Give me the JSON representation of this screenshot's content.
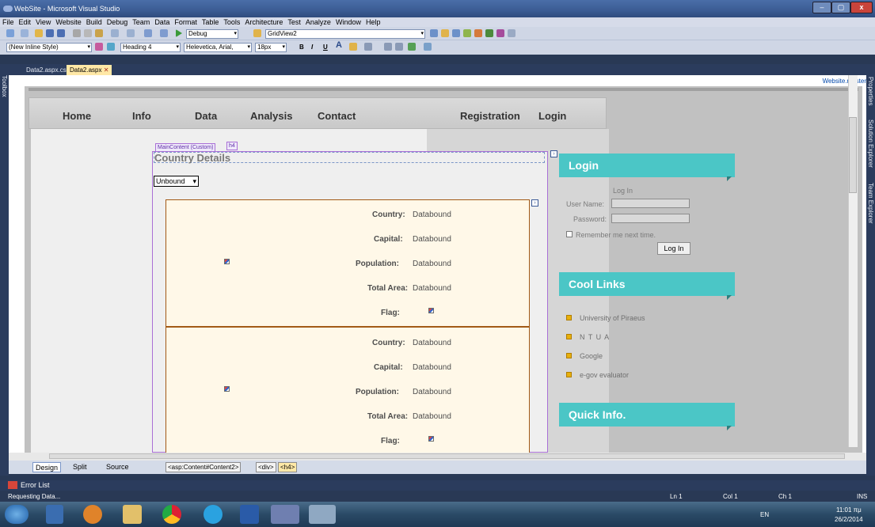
{
  "window": {
    "title": "WebSite - Microsoft Visual Studio",
    "min": "–",
    "max": "▢",
    "close": "x"
  },
  "menu": [
    "File",
    "Edit",
    "View",
    "Website",
    "Build",
    "Debug",
    "Team",
    "Data",
    "Format",
    "Table",
    "Tools",
    "Architecture",
    "Test",
    "Analyze",
    "Window",
    "Help"
  ],
  "toolbar1": {
    "config": "Debug",
    "target": "GridView2"
  },
  "toolbar2": {
    "style": "(New Inline Style)",
    "block": "Heading 4",
    "font": "Helevetica, Arial,",
    "size": "18px",
    "bold": "B",
    "italic": "I",
    "underline": "U",
    "fontcolor": "A"
  },
  "toolbox_label": "Toolbox",
  "tabs": [
    {
      "label": "Data2.aspx.cs"
    },
    {
      "label": "Data2.aspx",
      "close": "✕"
    }
  ],
  "master_label": "Website.master",
  "nav": {
    "home": "Home",
    "info": "Info",
    "data": "Data",
    "analysis": "Analysis",
    "contact": "Contact",
    "registration": "Registration",
    "login": "Login"
  },
  "main": {
    "content_tag": "MainContent (Custom)",
    "h4_tag": "h4",
    "heading": "Country Details",
    "unbound": "Unbound"
  },
  "record_labels": {
    "country": "Country:",
    "capital": "Capital:",
    "population": "Population:",
    "area": "Total Area:",
    "flag": "Flag:"
  },
  "databound": "Databound",
  "sidebar": {
    "login_head": "Login",
    "login_title": "Log In",
    "user_label": "User Name:",
    "pass_label": "Password:",
    "remember": "Remember me next time.",
    "login_button": "Log In",
    "links_head": "Cool Links",
    "links": [
      "University of Piraeus",
      "N T U A",
      "Google",
      "e-gov evaluator"
    ],
    "quick_head": "Quick Info."
  },
  "views": {
    "design": "Design",
    "split": "Split",
    "source": "Source"
  },
  "breadcrumb": [
    "<asp:Content#Content2>",
    "<div>",
    "<h4>"
  ],
  "error_list": "Error List",
  "status": {
    "text": "Requesting Data...",
    "ln": "Ln 1",
    "col": "Col 1",
    "ch": "Ch 1",
    "ins": "INS"
  },
  "tray": {
    "lang": "EN",
    "time": "11:01 πμ",
    "date": "26/2/2014"
  },
  "right_panel": [
    "Properties",
    "Solution Explorer",
    "Team Explorer"
  ],
  "colors": {
    "accent": "#4bc6c6",
    "record_bg": "#fff8e8",
    "vs_frame": "#293955"
  }
}
